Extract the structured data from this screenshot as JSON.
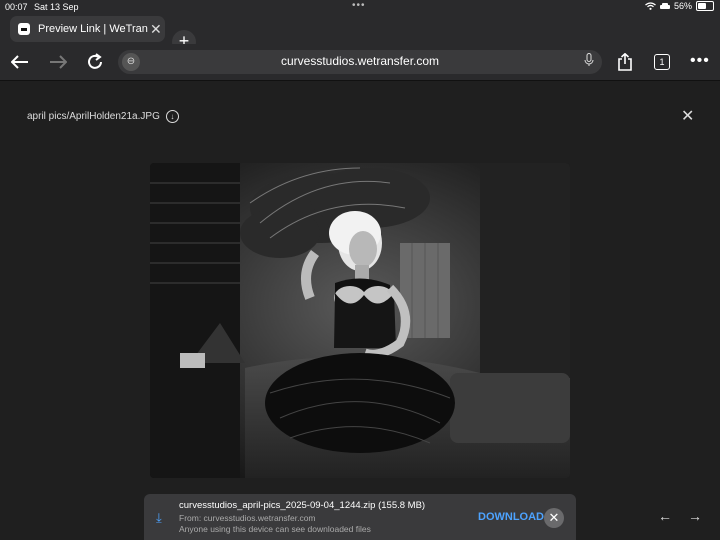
{
  "status": {
    "time": "00:07",
    "date": "Sat 13 Sep",
    "battery": "56%",
    "battery_level": 0.56
  },
  "tab": {
    "title": "Preview Link | WeTransfer",
    "new_tab_label": "+"
  },
  "nav": {
    "url": "curvesstudios.wetransfer.com",
    "tab_count": "1"
  },
  "viewer": {
    "file_path": "april pics/AprilHolden21a.JPG",
    "image_alt": "Black and white photo of a woman in a corset and feather skirt holding a large feather fan"
  },
  "download": {
    "filename": "curvesstudios_april-pics_2025-09-04_1244.zip (155.8 MB)",
    "from": "From: curvesstudios.wetransfer.com",
    "note": "Anyone using this device can see downloaded files",
    "button": "DOWNLOAD"
  },
  "colors": {
    "accent": "#4da3ff",
    "chrome": "#2a2a2c",
    "page_bg": "#1f1f1f"
  }
}
